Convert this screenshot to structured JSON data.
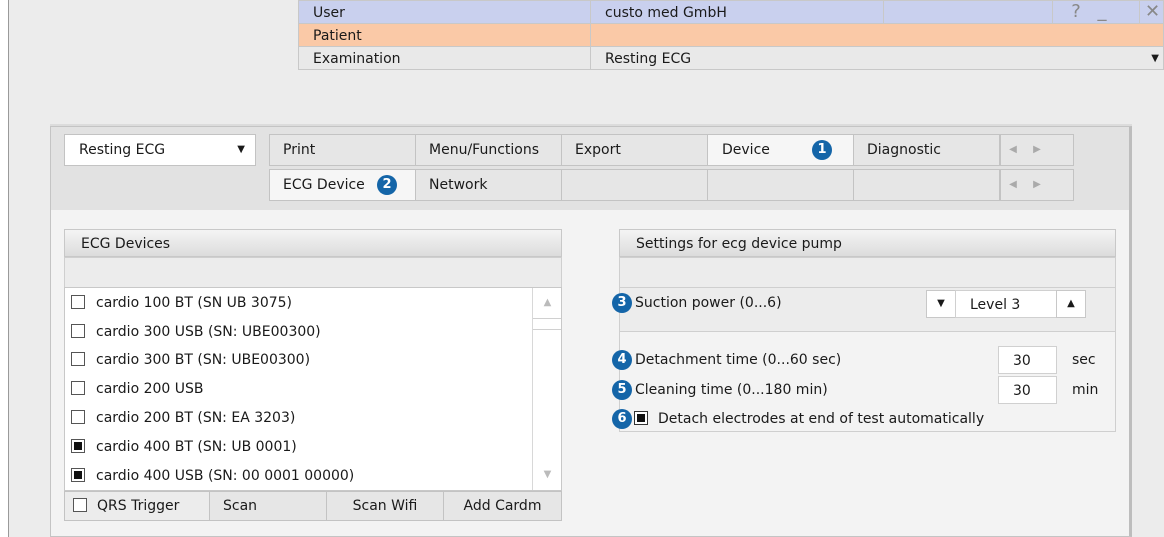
{
  "header": {
    "rows": [
      {
        "label": "User",
        "value": "custo med GmbH"
      },
      {
        "label": "Patient",
        "value": ""
      },
      {
        "label": "Examination",
        "value": "Resting ECG"
      }
    ],
    "help_symbol": "?",
    "minimize_symbol": "_",
    "close_symbol": "✕",
    "exam_dropdown_symbol": "▼"
  },
  "module_select": {
    "value": "Resting ECG",
    "arrow": "▼"
  },
  "tabs_row1": [
    {
      "label": "Print"
    },
    {
      "label": "Menu/Functions"
    },
    {
      "label": "Export"
    },
    {
      "label": "Device",
      "badge": "1",
      "active": true
    },
    {
      "label": "Diagnostic"
    }
  ],
  "tabs_row2": [
    {
      "label": "ECG Device",
      "badge": "2",
      "active": true
    },
    {
      "label": "Network"
    }
  ],
  "nav_arrows": {
    "left": "◀",
    "right": "▶"
  },
  "ecg_devices": {
    "title": "ECG Devices",
    "devices": [
      {
        "label": "cardio 100 BT (SN UB 3075)",
        "checked": false
      },
      {
        "label": "cardio 300 USB (SN: UBE00300)",
        "checked": false
      },
      {
        "label": "cardio 300 BT (SN: UBE00300)",
        "checked": false
      },
      {
        "label": "cardio 200 USB",
        "checked": false
      },
      {
        "label": "cardio 200 BT (SN: EA 3203)",
        "checked": false
      },
      {
        "label": "cardio 400 BT (SN: UB 0001)",
        "checked": true
      },
      {
        "label": "cardio 400 USB (SN: 00 0001 00000)",
        "checked": true
      }
    ],
    "scroll_up": "▲",
    "scroll_down": "▼",
    "qrs_trigger_label": "QRS Trigger",
    "scan_label": "Scan",
    "scan_wifi_label": "Scan Wifi",
    "add_cardm_label": "Add Cardm"
  },
  "pump_settings": {
    "title": "Settings for ecg device pump",
    "suction": {
      "badge": "3",
      "label": "Suction power (0...6)",
      "value": "Level 3",
      "down": "▼",
      "up": "▲"
    },
    "detachment": {
      "badge": "4",
      "label": "Detachment time (0...60 sec)",
      "value": "30",
      "unit": "sec"
    },
    "cleaning": {
      "badge": "5",
      "label": "Cleaning time (0...180 min)",
      "value": "30",
      "unit": "min"
    },
    "auto_detach": {
      "badge": "6",
      "label": "Detach electrodes at end of test automatically",
      "checked": true
    }
  },
  "colors": {
    "user_row": "#c9d0ee",
    "patient_row": "#fac9a7",
    "badge": "#1465a8"
  }
}
